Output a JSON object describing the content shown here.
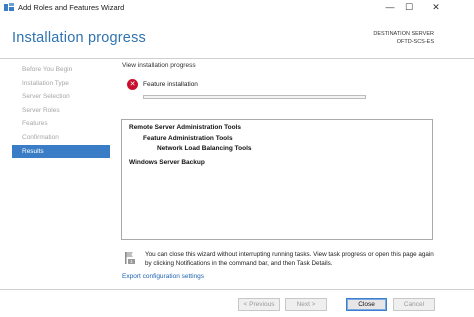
{
  "window": {
    "title": "Add Roles and Features Wizard",
    "minimize_glyph": "—",
    "maximize_glyph": "☐",
    "close_glyph": "✕"
  },
  "header": {
    "page_title": "Installation progress",
    "destination_label": "DESTINATION SERVER",
    "destination_server": "OFTD-SCS-ES"
  },
  "sidebar": {
    "items": [
      {
        "label": "Before You Begin",
        "active": false
      },
      {
        "label": "Installation Type",
        "active": false
      },
      {
        "label": "Server Selection",
        "active": false
      },
      {
        "label": "Server Roles",
        "active": false
      },
      {
        "label": "Features",
        "active": false
      },
      {
        "label": "Confirmation",
        "active": false
      },
      {
        "label": "Results",
        "active": true
      }
    ]
  },
  "main": {
    "subtitle": "View installation progress",
    "status_icon": "error-icon",
    "status_icon_glyph": "✕",
    "status_text": "Feature installation",
    "progress_fraction": 0,
    "results": [
      "Remote Server Administration Tools",
      "Feature Administration Tools",
      "Network Load Balancing Tools",
      "Windows Server Backup"
    ],
    "note": "You can close this wizard without interrupting running tasks. View task progress or open this page again by clicking Notifications in the command bar, and then Task Details.",
    "export_link": "Export configuration settings"
  },
  "footer": {
    "previous_label": "< Previous",
    "next_label": "Next >",
    "close_label": "Close",
    "cancel_label": "Cancel"
  },
  "colors": {
    "accent": "#2f73b0",
    "nav_active": "#3a7dc6",
    "error": "#c8102e",
    "link": "#1f63b0"
  }
}
